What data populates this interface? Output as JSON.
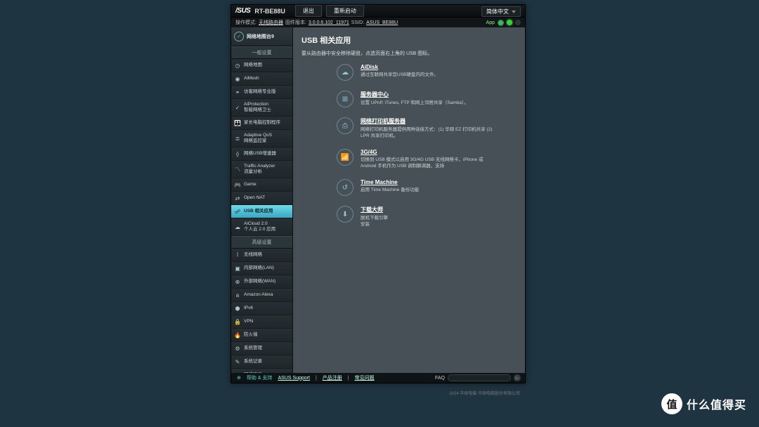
{
  "header": {
    "brand": "/SUS",
    "model": "RT-BE88U",
    "logout": "退出",
    "reboot": "重新启动",
    "language": "简体中文"
  },
  "status": {
    "mode_label": "操作模式:",
    "mode_value": "无线路由器",
    "fw_label": "固件版本:",
    "fw_value": "3.0.0.6.102_11971",
    "ssid_label": "SSID:",
    "ssid_value": "ASUS_BE88U",
    "app": "App"
  },
  "sidebar": {
    "top": "网络地图台9",
    "sec_general": "一般设置",
    "sec_advanced": "高级设置",
    "general": [
      {
        "label": "网络地图",
        "icon": "◷"
      },
      {
        "label": "AiMesh",
        "icon": "◉"
      },
      {
        "label": "访客网络专业版",
        "icon": "⚭"
      },
      {
        "label": "AiProtection\n智能网络卫士",
        "icon": "✓"
      },
      {
        "label": "家长电脑控制程序",
        "icon": "👪"
      },
      {
        "label": "Adaptive QoS\n网络监控家",
        "icon": "≣"
      },
      {
        "label": "网络USB增速器",
        "icon": "⟠"
      },
      {
        "label": "Traffic Analyzer\n流量分析",
        "icon": "〽"
      },
      {
        "label": "Game",
        "icon": "🎮"
      },
      {
        "label": "Open NAT",
        "icon": "⇄"
      },
      {
        "label": "USB 相关应用",
        "icon": "☍"
      },
      {
        "label": "AiCloud 2.0\n个人云 2.0 应用",
        "icon": "☁"
      }
    ],
    "active_index": 10,
    "advanced": [
      {
        "label": "无线网络",
        "icon": "⟟"
      },
      {
        "label": "内部网络(LAN)",
        "icon": "▣"
      },
      {
        "label": "外部网络(WAN)",
        "icon": "⊕"
      },
      {
        "label": "Amazon Alexa",
        "icon": "a"
      },
      {
        "label": "IPv6",
        "icon": "⬢"
      },
      {
        "label": "VPN",
        "icon": "🔒"
      },
      {
        "label": "防火墙",
        "icon": "🔥"
      },
      {
        "label": "系统管理",
        "icon": "⚙"
      },
      {
        "label": "系统记录",
        "icon": "✎"
      },
      {
        "label": "网络工具",
        "icon": "⚒"
      }
    ]
  },
  "page": {
    "title": "USB 相关应用",
    "desc": "要从路由器中安全移除硬盘，点选页面右上角的 USB 图标。"
  },
  "apps": [
    {
      "title": "AiDisk",
      "desc": "通过互联网共享您USB硬盘内的文件。",
      "icon": "☁"
    },
    {
      "title": "服务器中心",
      "desc": "设置 UPnP, iTunes, FTP 和网上邻居共享（Samba）。",
      "icon": "⊞"
    },
    {
      "title": "网络打印机服务器",
      "desc": "网络打印机服务器提供两种连接方式：(1) 华硕 EZ 打印机共享 (2) LPR 共享打印机。",
      "icon": "⎙"
    },
    {
      "title": "3G/4G",
      "desc": "切换到 USB 模式以启用 3G/4G USB 无线网络卡，iPhone 或 Android 手机作为 USB 调制解调器，支持",
      "icon": "📶"
    },
    {
      "title": "Time Machine",
      "desc": "启用 Time Machine 备份功能",
      "icon": "↺"
    },
    {
      "title": "下载大师",
      "desc": "脱机下载引擎\n安装",
      "icon": "⬇"
    }
  ],
  "footer": {
    "help": "帮助 & 支持",
    "links": [
      "ASUS Support",
      "产品注册",
      "常见问题"
    ],
    "faq": "FAQ"
  },
  "copyright": "2024 华硕电脑 华硕电脑股份有限公司",
  "watermark": {
    "circle": "值",
    "text": "什么值得买"
  }
}
